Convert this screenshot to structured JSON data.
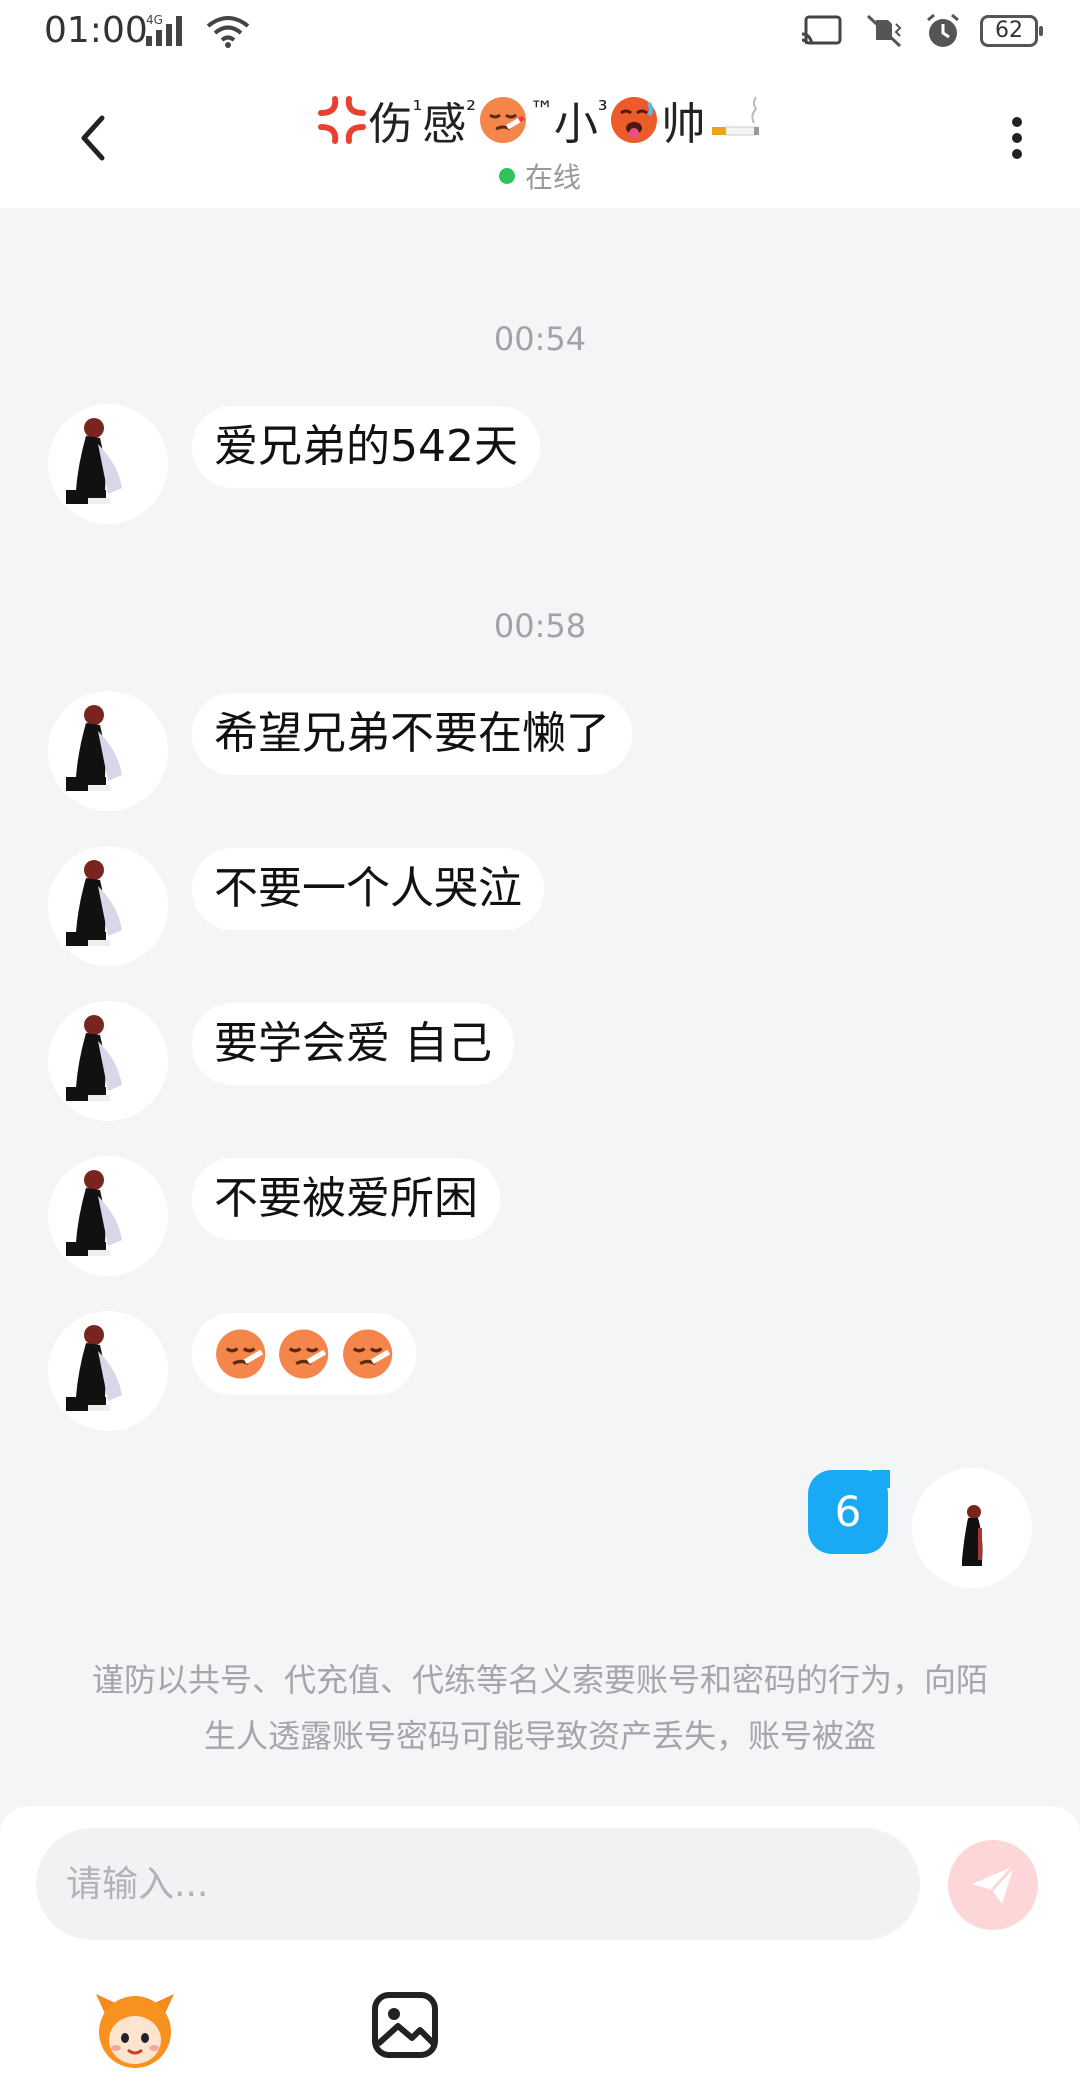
{
  "status_bar": {
    "time": "01:00",
    "network": "4G",
    "battery": "62"
  },
  "header": {
    "title_parts": [
      "伤",
      "¹",
      "感",
      "²",
      "™",
      "小",
      "³",
      "帅"
    ],
    "status": "在线"
  },
  "messages": [
    {
      "timestamp": "00:54"
    },
    {
      "text": "爱兄弟的542天"
    },
    {
      "timestamp": "00:58"
    },
    {
      "text": "希望兄弟不要在懒了"
    },
    {
      "text": "不要一个人哭泣"
    },
    {
      "text": "要学会爱 自己"
    },
    {
      "text": "不要被爱所困"
    }
  ],
  "my_message": {
    "text": "6"
  },
  "warning": "谨防以共号、代充值、代练等名义索要账号和密码的行为，向陌生人透露账号密码可能导致资产丢失，账号被盗",
  "input": {
    "placeholder": "请输入..."
  },
  "icons": {
    "back": "chevron-left-icon",
    "more": "more-vertical-icon",
    "send": "send-icon",
    "emoji_tool": "mascot-emoji-icon",
    "image_tool": "image-icon"
  },
  "colors": {
    "accent": "#1aa9f4",
    "online": "#2fc35d",
    "send_disabled": "#fdd7d7",
    "background": "#f4f5f7"
  }
}
